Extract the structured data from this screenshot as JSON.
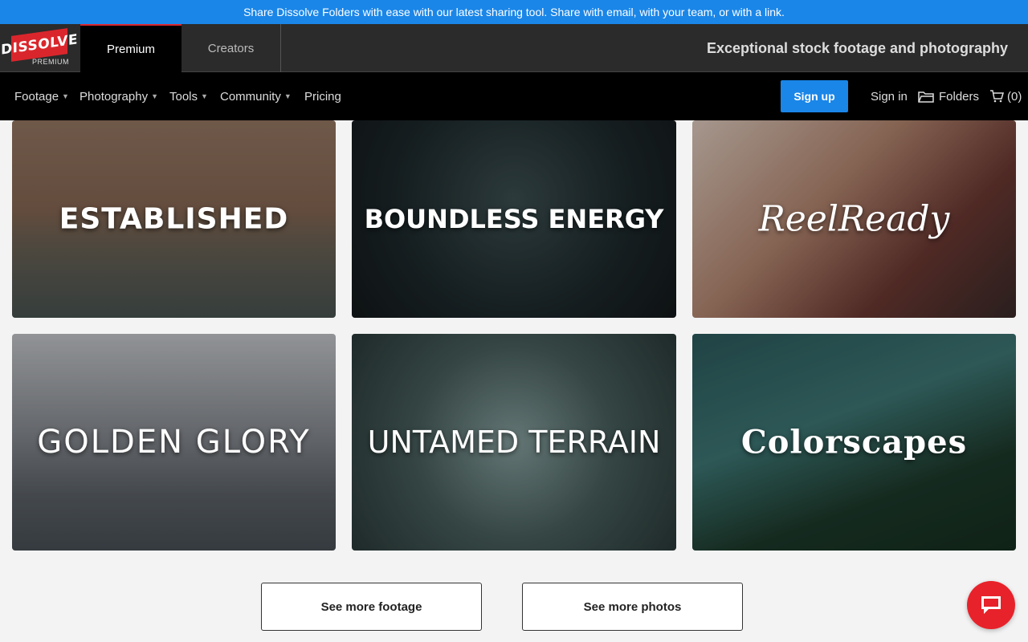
{
  "banner": {
    "text": "Share Dissolve Folders with ease with our latest sharing tool. Share with email, with your team, or with a link."
  },
  "logo": {
    "name": "DISSOLVE",
    "sub": "PREMIUM"
  },
  "top_tabs": [
    {
      "label": "Premium"
    },
    {
      "label": "Creators"
    }
  ],
  "tagline": "Exceptional stock footage and photography",
  "nav": {
    "items": [
      {
        "label": "Footage"
      },
      {
        "label": "Photography"
      },
      {
        "label": "Tools"
      },
      {
        "label": "Community"
      },
      {
        "label": "Pricing"
      }
    ],
    "signup": "Sign up",
    "signin": "Sign in",
    "folders": "Folders",
    "cart": "(0)"
  },
  "cards": [
    {
      "title": "ESTABLISHED"
    },
    {
      "title": "BOUNDLESS ENERGY"
    },
    {
      "title": "ReelReady"
    },
    {
      "title": "GOLDEN GLORY"
    },
    {
      "title": "UNTAMED TERRAIN"
    },
    {
      "title": "Colorscapes"
    }
  ],
  "buttons": {
    "footage": "See more footage",
    "photos": "See more photos"
  },
  "colors": {
    "accent_blue": "#1a86e8",
    "brand_red": "#d9262c",
    "chat_red": "#e8222a"
  },
  "icons": {
    "folder": "folder-icon",
    "cart": "cart-icon",
    "chat": "chat-icon"
  }
}
